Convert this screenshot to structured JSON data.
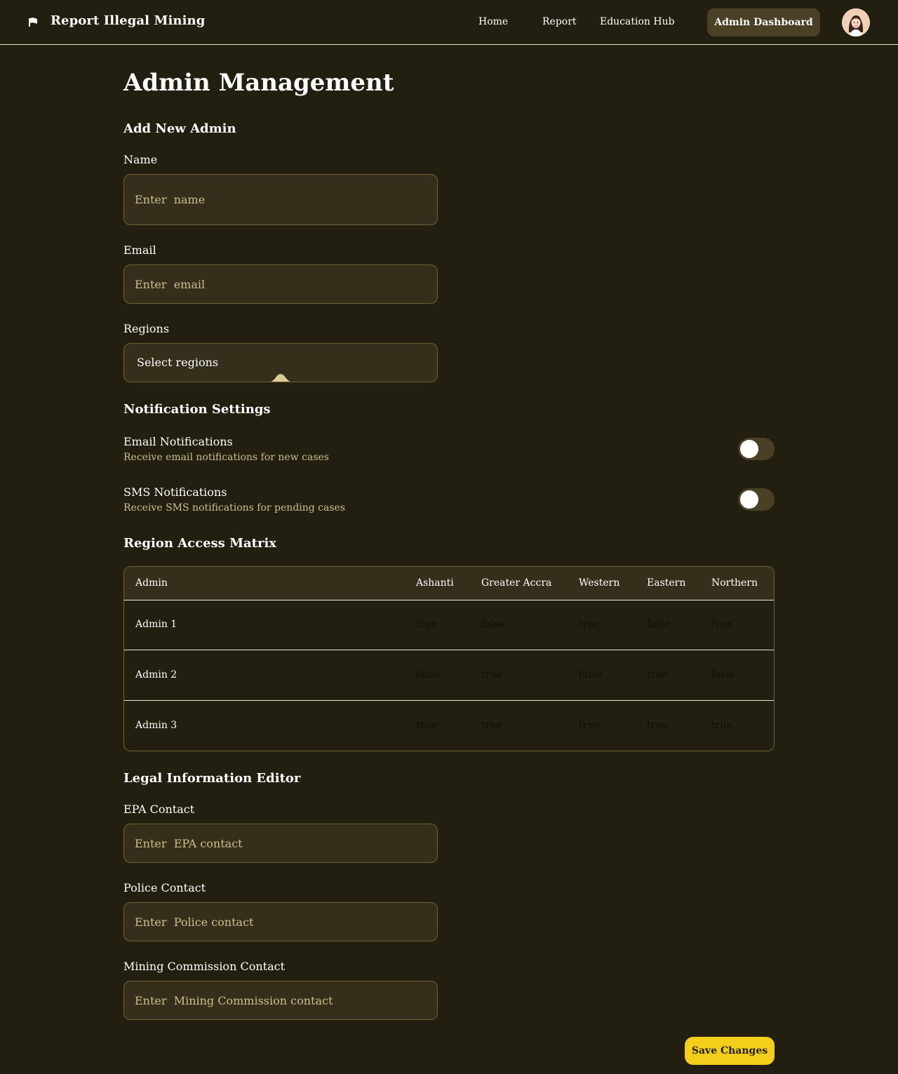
{
  "header": {
    "app_title": "Report Illegal Mining",
    "nav": [
      "Home",
      "Report",
      "Education Hub"
    ],
    "admin_button": "Admin Dashboard"
  },
  "page": {
    "title": "Admin Management"
  },
  "add_admin": {
    "heading": "Add New Admin",
    "name_label": "Name",
    "name_placeholder": "Enter  name",
    "email_label": "Email",
    "email_placeholder": "Enter  email",
    "regions_label": "Regions",
    "regions_value": "Select  regions"
  },
  "notifications": {
    "heading": "Notification Settings",
    "items": [
      {
        "title": "Email Notifications",
        "desc": "Receive email notifications for new cases",
        "enabled": false
      },
      {
        "title": "SMS Notifications",
        "desc": "Receive SMS notifications for pending cases",
        "enabled": false
      }
    ]
  },
  "matrix": {
    "heading": "Region Access Matrix",
    "columns": [
      "Admin",
      "Ashanti",
      "Greater Accra",
      "Western",
      "Eastern",
      "Northern"
    ],
    "rows": [
      {
        "name": "Admin 1",
        "values": [
          "true",
          "false",
          "true",
          "false",
          "true"
        ]
      },
      {
        "name": "Admin 2",
        "values": [
          "false",
          "true",
          "false",
          "true",
          "false"
        ]
      },
      {
        "name": "Admin 3",
        "values": [
          "true",
          "true",
          "true",
          "true",
          "true"
        ]
      }
    ]
  },
  "legal": {
    "heading": "Legal Information Editor",
    "epa_label": "EPA Contact",
    "epa_placeholder": "Enter  EPA contact",
    "police_label": "Police Contact",
    "police_placeholder": "Enter  Police contact",
    "mining_label": "Mining Commission Contact",
    "mining_placeholder": "Enter  Mining Commission contact"
  },
  "save_button": "Save Changes",
  "colors": {
    "background": "#221f10",
    "input_bg": "#352e1b",
    "input_border": "#6e6430",
    "accent": "#f3ce1a",
    "muted_text": "#cbbf8f"
  },
  "icons": {
    "logo": "flag-icon",
    "select": "chevron-up-icon"
  }
}
